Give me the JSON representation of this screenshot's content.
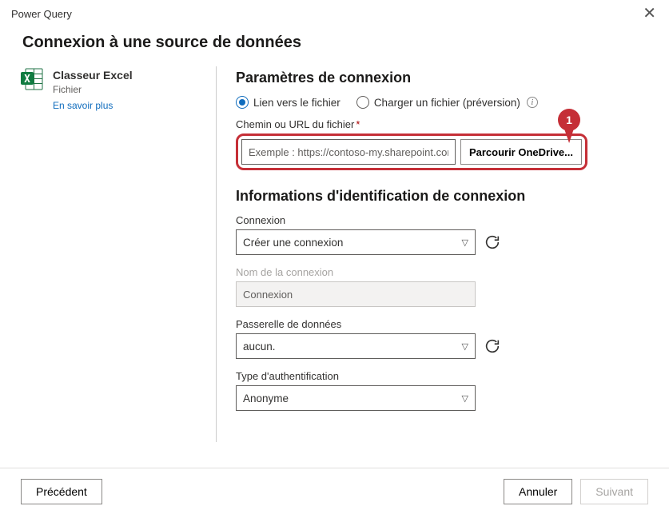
{
  "titlebar": {
    "app_name": "Power Query"
  },
  "dialog": {
    "title": "Connexion à une source de données",
    "connector": {
      "name": "Classeur Excel",
      "subtitle": "Fichier",
      "learn_more": "En savoir plus"
    }
  },
  "settings": {
    "heading": "Paramètres de connexion",
    "radio_link": "Lien vers le fichier",
    "radio_upload": "Charger un fichier (préversion)",
    "path_label": "Chemin ou URL du fichier",
    "path_placeholder": "Exemple : https://contoso-my.sharepoint.com/p...",
    "browse_label": "Parcourir OneDrive..."
  },
  "callouts": {
    "one": "1"
  },
  "credentials": {
    "heading": "Informations d'identification de connexion",
    "connection_label": "Connexion",
    "connection_value": "Créer une connexion",
    "name_label": "Nom de la connexion",
    "name_placeholder": "Connexion",
    "gateway_label": "Passerelle de données",
    "gateway_value": "aucun.",
    "auth_label": "Type d'authentification",
    "auth_value": "Anonyme"
  },
  "footer": {
    "back": "Précédent",
    "cancel": "Annuler",
    "next": "Suivant"
  }
}
